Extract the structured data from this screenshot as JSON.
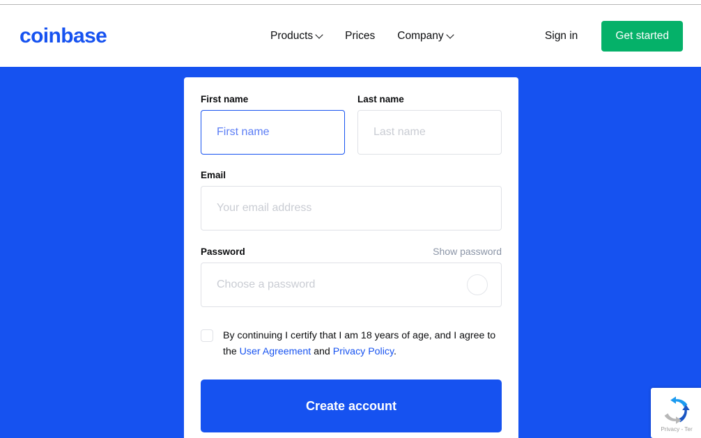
{
  "header": {
    "logo_text": "coinbase",
    "nav": [
      {
        "label": "Products",
        "has_dropdown": true
      },
      {
        "label": "Prices",
        "has_dropdown": false
      },
      {
        "label": "Company",
        "has_dropdown": true
      }
    ],
    "sign_in_label": "Sign in",
    "get_started_label": "Get started"
  },
  "form": {
    "first_name": {
      "label": "First name",
      "placeholder": "First name",
      "value": "",
      "focused": true
    },
    "last_name": {
      "label": "Last name",
      "placeholder": "Last name",
      "value": "",
      "focused": false
    },
    "email": {
      "label": "Email",
      "placeholder": "Your email address",
      "value": "",
      "focused": false
    },
    "password": {
      "label": "Password",
      "placeholder": "Choose a password",
      "value": "",
      "focused": false,
      "show_password_label": "Show password"
    },
    "terms": {
      "checked": false,
      "text_part_1": "By continuing I certify that I am 18 years of age, and I agree to the ",
      "link_user_agreement": "User Agreement",
      "text_part_2": " and ",
      "link_privacy_policy": "Privacy Policy",
      "text_part_3": "."
    },
    "submit_label": "Create account"
  },
  "recaptcha": {
    "links_text": "Privacy - Ter"
  },
  "colors": {
    "brand_blue": "#1652f0",
    "brand_green": "#05b169",
    "text_dark": "#0a0b0d",
    "placeholder_gray": "#c9ccd3",
    "border_gray": "#dfe1e6"
  }
}
